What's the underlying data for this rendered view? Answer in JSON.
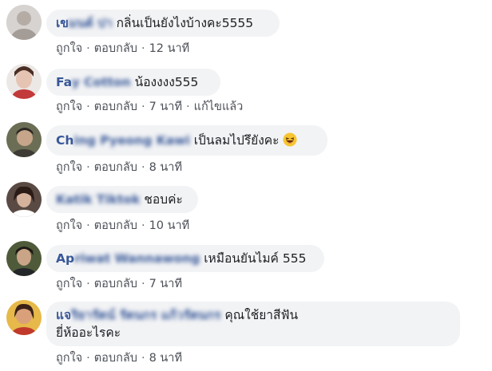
{
  "comments": [
    {
      "name_visible": "เข",
      "name_blurred": "มนต์ ปา",
      "text": "กลิ่นเป็นยังไงบ้างคะ5555",
      "actions": {
        "like": "ถูกใจ",
        "reply": "ตอบกลับ",
        "time": "12 นาที",
        "edited": ""
      }
    },
    {
      "name_visible": "Fa",
      "name_blurred": "y Cotton",
      "text": "น้องงงง555",
      "actions": {
        "like": "ถูกใจ",
        "reply": "ตอบกลับ",
        "time": "7 นาที",
        "edited": "แก้ไขแล้ว"
      }
    },
    {
      "name_visible": "Ch",
      "name_blurred": "ing Pyeong Kawi",
      "text": "เป็นลมไปรึยังคะ",
      "emoji": "laughing-emoji",
      "actions": {
        "like": "ถูกใจ",
        "reply": "ตอบกลับ",
        "time": "8 นาที",
        "edited": ""
      }
    },
    {
      "name_visible": "",
      "name_blurred": "Katik Tiktok",
      "text": "ชอบค่ะ",
      "actions": {
        "like": "ถูกใจ",
        "reply": "ตอบกลับ",
        "time": "10 นาที",
        "edited": ""
      }
    },
    {
      "name_visible": "Ap",
      "name_blurred": "riwat Wannawong",
      "text": "เหมือนยันไมค์ 555",
      "actions": {
        "like": "ถูกใจ",
        "reply": "ตอบกลับ",
        "time": "7 นาที",
        "edited": ""
      }
    },
    {
      "name_visible": "แจ",
      "name_blurred": "ริยารัตน์ รัตนกร แก้วรัตนกร",
      "text": "คุณใช้ยาสีฟัน",
      "text_line2": "ยี่ห้ออะไรคะ",
      "actions": {
        "like": "ถูกใจ",
        "reply": "ตอบกลับ",
        "time": "8 นาที",
        "edited": ""
      }
    }
  ]
}
